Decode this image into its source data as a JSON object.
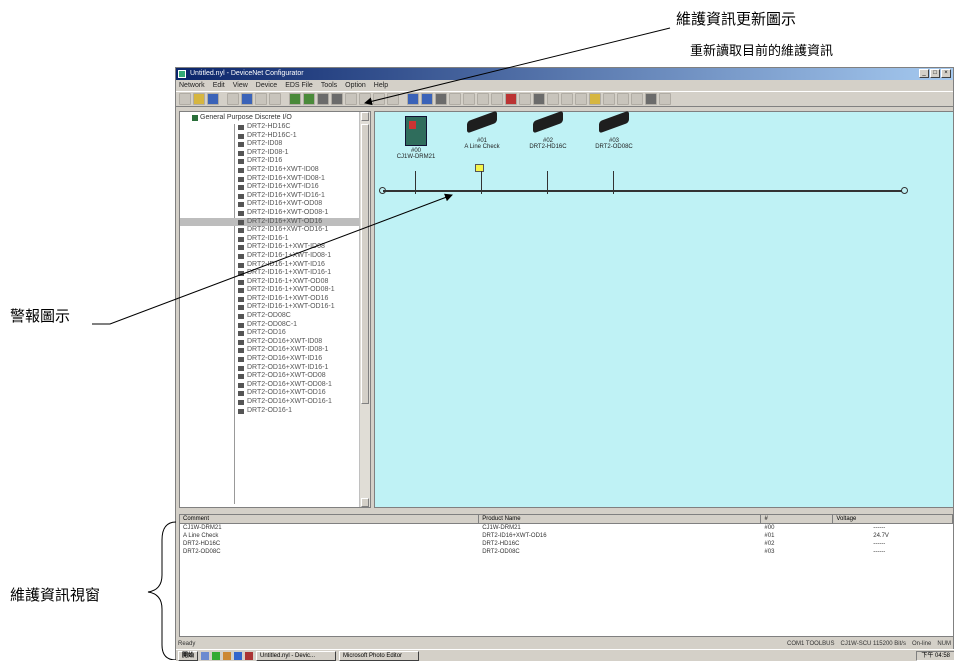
{
  "callouts": {
    "update_icon": "維護資訊更新圖示",
    "update_desc": "重新讀取目前的維護資訊",
    "warning_icon": "警報圖示",
    "maint_window": "維護資訊視窗"
  },
  "window": {
    "title": "Untitled.nyl - DeviceNet Configurator",
    "menus": [
      "Network",
      "Edit",
      "View",
      "Device",
      "EDS File",
      "Tools",
      "Option",
      "Help"
    ]
  },
  "tree": {
    "root": "General Purpose Discrete I/O",
    "items": [
      "DRT2-HD16C",
      "DRT2-HD16C-1",
      "DRT2-ID08",
      "DRT2-ID08-1",
      "DRT2-ID16",
      "DRT2-ID16+XWT-ID08",
      "DRT2-ID16+XWT-ID08-1",
      "DRT2-ID16+XWT-ID16",
      "DRT2-ID16+XWT-ID16-1",
      "DRT2-ID16+XWT-OD08",
      "DRT2-ID16+XWT-OD08-1",
      "DRT2-ID16+XWT-OD16",
      "DRT2-ID16+XWT-OD16-1",
      "DRT2-ID16-1",
      "DRT2-ID16-1+XWT-ID08",
      "DRT2-ID16-1+XWT-ID08-1",
      "DRT2-ID16-1+XWT-ID16",
      "DRT2-ID16-1+XWT-ID16-1",
      "DRT2-ID16-1+XWT-OD08",
      "DRT2-ID16-1+XWT-OD08-1",
      "DRT2-ID16-1+XWT-OD16",
      "DRT2-ID16-1+XWT-OD16-1",
      "DRT2-OD08C",
      "DRT2-OD08C-1",
      "DRT2-OD16",
      "DRT2-OD16+XWT-ID08",
      "DRT2-OD16+XWT-ID08-1",
      "DRT2-OD16+XWT-ID16",
      "DRT2-OD16+XWT-ID16-1",
      "DRT2-OD16+XWT-OD08",
      "DRT2-OD16+XWT-OD08-1",
      "DRT2-OD16+XWT-OD16",
      "DRT2-OD16+XWT-OD16-1",
      "DRT2-OD16-1"
    ],
    "selected_index": 11
  },
  "nodes": [
    {
      "addr": "#00",
      "label": "CJ1W-DRM21",
      "kind": "master"
    },
    {
      "addr": "#01",
      "label": "A Line Check",
      "kind": "slave",
      "warning": true
    },
    {
      "addr": "#02",
      "label": "DRT2-HD16C",
      "kind": "slave"
    },
    {
      "addr": "#03",
      "label": "DRT2-OD08C",
      "kind": "slave"
    }
  ],
  "maint_list": {
    "headers": [
      "Comment",
      "Product Name",
      "#",
      "Voltage"
    ],
    "rows": [
      [
        "CJ1W-DRM21",
        "CJ1W-DRM21",
        "#00",
        "------"
      ],
      [
        "A Line Check",
        "DRT2-ID16+XWT-OD16",
        "#01",
        "24.7V"
      ],
      [
        "DRT2-HD16C",
        "DRT2-HD16C",
        "#02",
        "------"
      ],
      [
        "DRT2-OD08C",
        "DRT2-OD08C",
        "#03",
        "------"
      ]
    ]
  },
  "status": {
    "left": "Ready",
    "tool": "COM1 TOOLBUS",
    "port": "CJ1W-SCU 115200 Bit/s",
    "online": "On-line",
    "num": "NUM"
  },
  "taskbar": {
    "start": "開始",
    "tasks": [
      "Untitled.nyl - Devic...",
      "Microsoft Photo Editor"
    ],
    "clock": "下午 04:58"
  }
}
